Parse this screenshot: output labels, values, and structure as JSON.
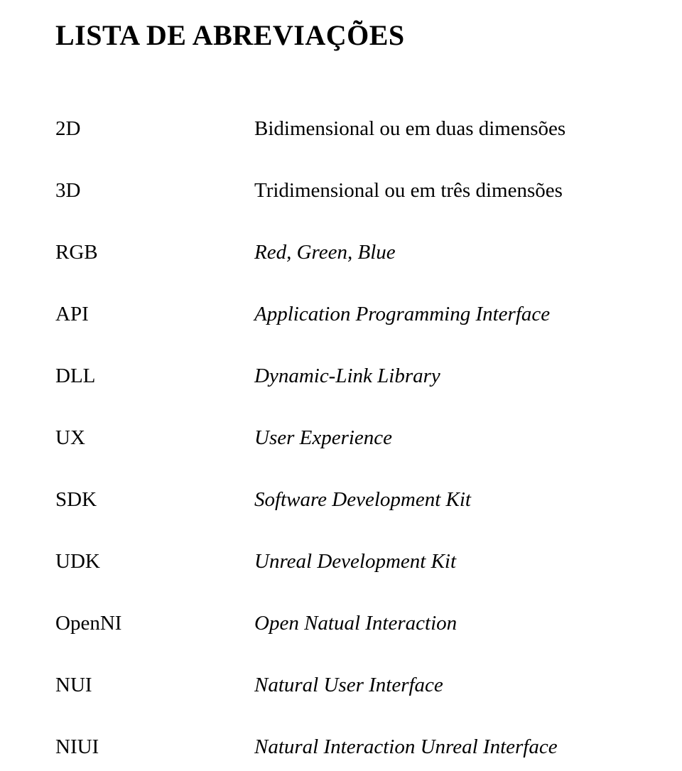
{
  "title": "LISTA DE ABREVIAÇÕES",
  "entries": [
    {
      "abbrev": "2D",
      "definition": "Bidimensional ou em duas dimensões",
      "italic": false
    },
    {
      "abbrev": "3D",
      "definition": "Tridimensional ou em três dimensões",
      "italic": false
    },
    {
      "abbrev": "RGB",
      "definition": "Red, Green, Blue",
      "italic": true
    },
    {
      "abbrev": "API",
      "definition": "Application Programming Interface",
      "italic": true
    },
    {
      "abbrev": "DLL",
      "definition": "Dynamic-Link Library",
      "italic": true
    },
    {
      "abbrev": "UX",
      "definition": "User Experience",
      "italic": true
    },
    {
      "abbrev": "SDK",
      "definition": "Software Development Kit",
      "italic": true
    },
    {
      "abbrev": "UDK",
      "definition": "Unreal Development Kit",
      "italic": true
    },
    {
      "abbrev": "OpenNI",
      "definition": "Open Natual Interaction",
      "italic": true
    },
    {
      "abbrev": "NUI",
      "definition": "Natural User Interface",
      "italic": true
    },
    {
      "abbrev": "NIUI",
      "definition": "Natural Interaction Unreal Interface",
      "italic": true
    }
  ]
}
